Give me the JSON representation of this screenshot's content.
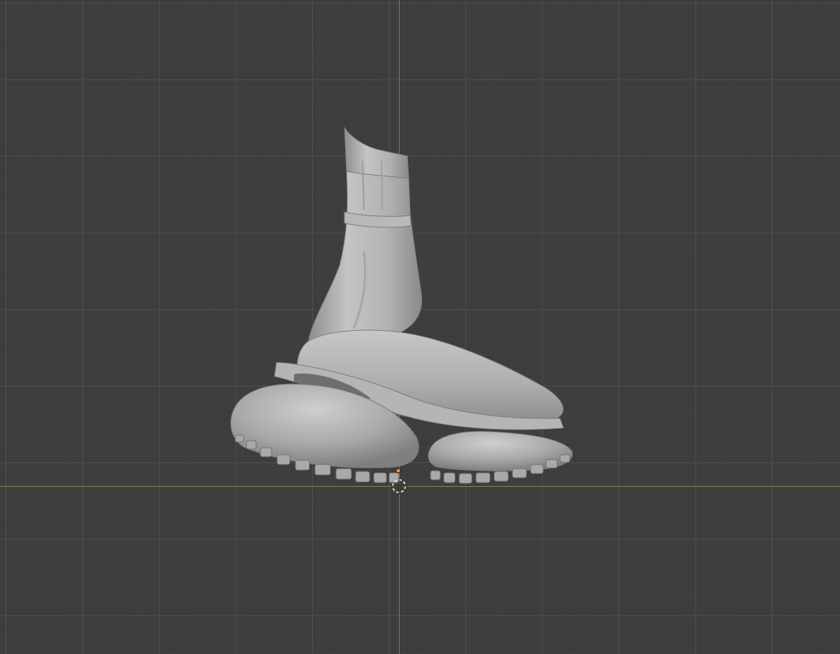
{
  "viewport": {
    "background": "#3d3d3d",
    "grid_color": "#5a5a5a",
    "axis_colors": {
      "x_axis": "#6f9a3a",
      "z_axis": "#4f7fc4"
    }
  },
  "scene": {
    "object": "boot-sculpt-mesh",
    "shading": "solid-gray-matcap",
    "origin_marker_color": "#ff9d2a"
  }
}
